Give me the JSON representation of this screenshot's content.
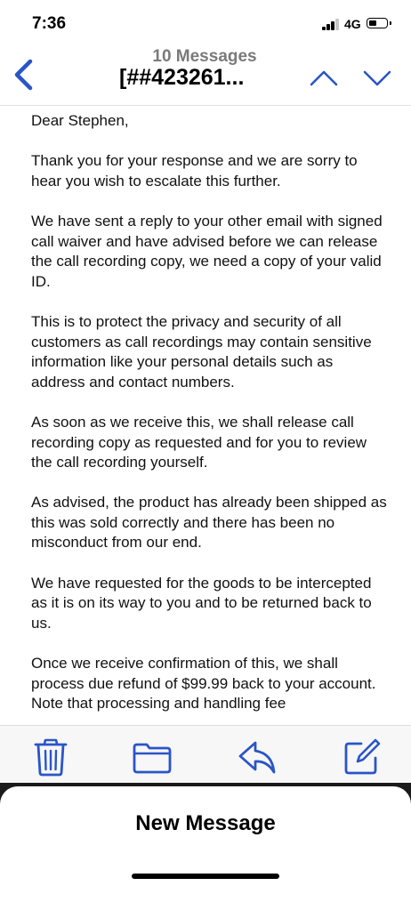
{
  "status_bar": {
    "time": "7:36",
    "network": "4G",
    "signal_bars": 3,
    "battery_level": 0.35
  },
  "nav": {
    "message_count": "10 Messages",
    "subject": "[##423261..."
  },
  "message": {
    "paragraphs": [
      "Dear Stephen,",
      "Thank you for your response and we are sorry to hear you wish to escalate this further.",
      "We have sent a reply to your other email with signed call waiver and have advised before we can release the call recording copy, we need a copy of your valid ID.",
      "This is to protect the privacy and security of all customers as call recordings may contain sensitive information like your personal details such as address and contact numbers.",
      "As soon as we receive this, we shall release call recording copy as requested and for you to review the call recording yourself.",
      "As advised, the product has already been shipped as this was sold correctly and there has been no misconduct from our end.",
      "We have requested for the goods to be intercepted as it is on its way to you and to be returned back to us.",
      "Once we receive confirmation of this, we shall process due refund of $99.99 back to your account. Note that processing and handling fee"
    ]
  },
  "toolbar": {
    "icons": [
      "trash-icon",
      "folder-icon",
      "reply-icon",
      "compose-icon"
    ],
    "accent_color": "#2a55c9"
  },
  "sheet": {
    "title": "New Message"
  },
  "colors": {
    "accent": "#2a55c9",
    "count_gray": "#7a7a7a"
  }
}
